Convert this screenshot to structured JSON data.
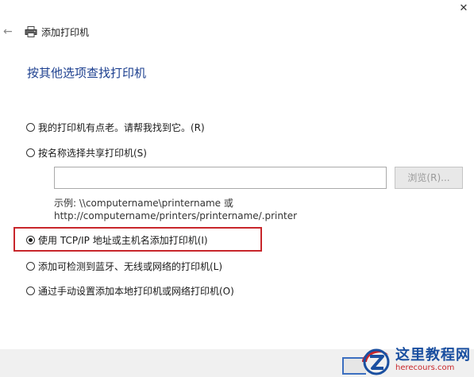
{
  "window": {
    "title": "添加打印机",
    "close_glyph": "✕",
    "back_glyph": "←"
  },
  "heading": "按其他选项查找打印机",
  "options": [
    {
      "label": "我的打印机有点老。请帮我找到它。(R)",
      "checked": false
    },
    {
      "label": "按名称选择共享打印机(S)",
      "checked": false
    },
    {
      "label": "使用 TCP/IP 地址或主机名添加打印机(I)",
      "checked": true
    },
    {
      "label": "添加可检测到蓝牙、无线或网络的打印机(L)",
      "checked": false
    },
    {
      "label": "通过手动设置添加本地打印机或网络打印机(O)",
      "checked": false
    }
  ],
  "share": {
    "input_value": "",
    "browse_label": "浏览(R)...",
    "example_line1": "示例: \\\\computername\\printername 或",
    "example_line2": "http://computername/printers/printername/.printer"
  },
  "watermark": {
    "main": "这里教程网",
    "url": "herecours.com"
  },
  "colors": {
    "heading": "#1c3f8f",
    "highlight": "#c8262b",
    "watermark_blue": "#1a4fa0",
    "watermark_red": "#c8262b"
  },
  "icons": [
    "close-icon",
    "back-arrow-icon",
    "printer-icon",
    "watermark-logo-icon"
  ]
}
